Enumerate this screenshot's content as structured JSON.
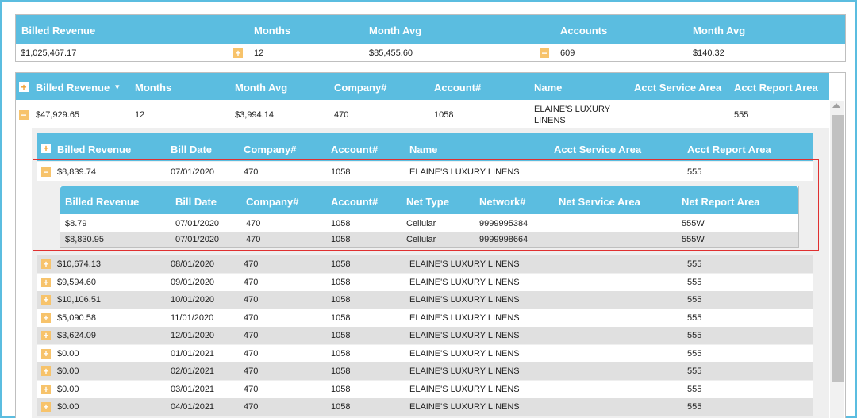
{
  "summary": {
    "headers": [
      "Billed Revenue",
      "Months",
      "Month Avg",
      "Accounts",
      "Month Avg"
    ],
    "values": [
      "$1,025,467.17",
      "12",
      "$85,455.60",
      "609",
      "$140.32"
    ]
  },
  "grid1": {
    "headers": [
      "Billed Revenue",
      "Months",
      "Month Avg",
      "Company#",
      "Account#",
      "Name",
      "Acct Service Area",
      "Acct Report Area"
    ],
    "row": [
      "$47,929.65",
      "12",
      "$3,994.14",
      "470",
      "1058",
      "ELAINE'S LUXURY",
      "LINENS",
      "555"
    ]
  },
  "grid2": {
    "headers": [
      "Billed Revenue",
      "Bill Date",
      "Company#",
      "Account#",
      "Name",
      "Acct Service Area",
      "Acct Report Area"
    ],
    "expanded_row": [
      "$8,839.74",
      "07/01/2020",
      "470",
      "1058",
      "ELAINE'S LUXURY LINENS",
      "",
      "555"
    ],
    "rows": [
      [
        "$10,674.13",
        "08/01/2020",
        "470",
        "1058",
        "ELAINE'S LUXURY LINENS",
        "",
        "555"
      ],
      [
        "$9,594.60",
        "09/01/2020",
        "470",
        "1058",
        "ELAINE'S LUXURY LINENS",
        "",
        "555"
      ],
      [
        "$10,106.51",
        "10/01/2020",
        "470",
        "1058",
        "ELAINE'S LUXURY LINENS",
        "",
        "555"
      ],
      [
        "$5,090.58",
        "11/01/2020",
        "470",
        "1058",
        "ELAINE'S LUXURY LINENS",
        "",
        "555"
      ],
      [
        "$3,624.09",
        "12/01/2020",
        "470",
        "1058",
        "ELAINE'S LUXURY LINENS",
        "",
        "555"
      ],
      [
        "$0.00",
        "01/01/2021",
        "470",
        "1058",
        "ELAINE'S LUXURY LINENS",
        "",
        "555"
      ],
      [
        "$0.00",
        "02/01/2021",
        "470",
        "1058",
        "ELAINE'S LUXURY LINENS",
        "",
        "555"
      ],
      [
        "$0.00",
        "03/01/2021",
        "470",
        "1058",
        "ELAINE'S LUXURY LINENS",
        "",
        "555"
      ],
      [
        "$0.00",
        "04/01/2021",
        "470",
        "1058",
        "ELAINE'S LUXURY LINENS",
        "",
        "555"
      ]
    ]
  },
  "grid3": {
    "headers": [
      "Billed Revenue",
      "Bill Date",
      "Company#",
      "Account#",
      "Net Type",
      "Network#",
      "Net Service Area",
      "Net Report Area"
    ],
    "rows": [
      [
        "$8.79",
        "07/01/2020",
        "470",
        "1058",
        "Cellular",
        "9999995384",
        "",
        "555W"
      ],
      [
        "$8,830.95",
        "07/01/2020",
        "470",
        "1058",
        "Cellular",
        "9999998664",
        "",
        "555W"
      ]
    ]
  },
  "icons": {
    "plus": "+",
    "minus": "−",
    "sort": "▾"
  },
  "colors": {
    "header": "#5bbde0",
    "expander": "#f7c36b",
    "highlight": "#e03030"
  }
}
